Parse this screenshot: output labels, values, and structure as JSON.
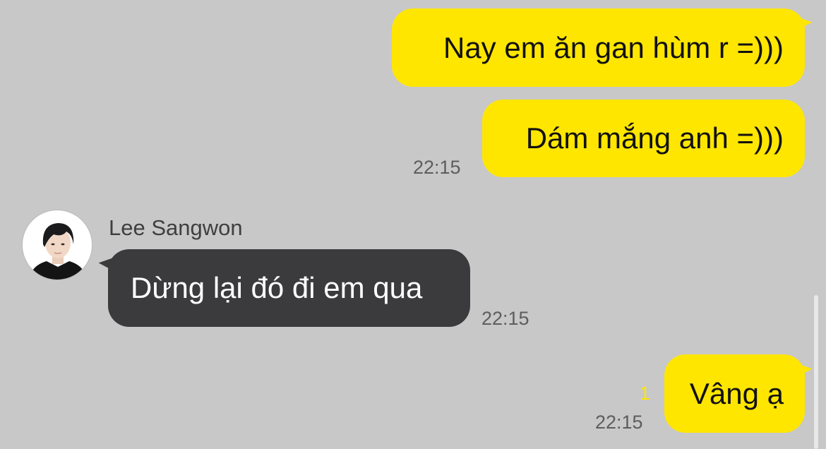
{
  "messages": [
    {
      "direction": "outgoing",
      "text": "Nay em ăn gan hùm r =)))"
    },
    {
      "direction": "outgoing",
      "text": "Dám mắng anh =)))",
      "time": "22:15"
    },
    {
      "direction": "incoming",
      "sender": "Lee Sangwon",
      "text": "Dừng lại đó đi em qua",
      "time": "22:15"
    },
    {
      "direction": "outgoing",
      "text": "Vâng ạ",
      "time": "22:15",
      "unread_count": "1"
    }
  ],
  "colors": {
    "background": "#c8c8c8",
    "outgoing_bubble": "#ffe600",
    "incoming_bubble": "#3b3b3d",
    "unread_indicator": "#ffe600"
  },
  "icons": {
    "avatar": "profile-photo"
  }
}
